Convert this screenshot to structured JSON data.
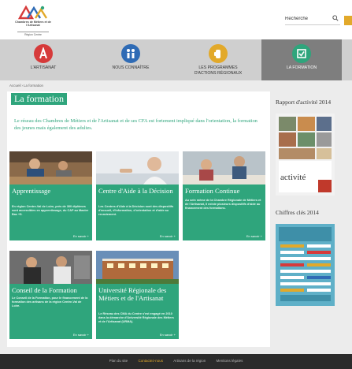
{
  "header": {
    "logo_title": "Chambres de Métiers et de l'Artisanat",
    "logo_region": "Région Centre",
    "search_placeholder": "Recherche"
  },
  "nav": [
    {
      "label": "L'ARTISANAT",
      "color": "#d63a3a",
      "icon": "letter-a-icon"
    },
    {
      "label": "NOUS CONNAÎTRE",
      "color": "#2f6bb5",
      "icon": "people-icon"
    },
    {
      "label": "LES PROGRAMMES D'ACTIONS RÉGIONAUX",
      "color": "#e2a92a",
      "icon": "hand-icon"
    },
    {
      "label": "LA FORMATION",
      "color": "#2fa57c",
      "icon": "book-icon",
      "active": true
    }
  ],
  "breadcrumb": {
    "home": "Accueil",
    "current": "La formation"
  },
  "main": {
    "title": "La formation",
    "intro": "Le réseau des Chambres de Métiers et de l'Artisanat et de ses CFA est fortement impliqué dans l'orientation, la formation des jeunes mais également des adultes."
  },
  "cards": [
    {
      "title": "Apprentissage",
      "desc": "En région Centre-Val de Loire, près de 300 diplômes sont accessibles en apprentissage, du CAP au Master Bac +5.",
      "more": "En savoir +"
    },
    {
      "title": "Centre d'Aide à la Décision",
      "desc": "Les Centres d'Aide à la Décision sont des dispositifs d'accueil, d'information, d'orientation et d'aide au recrutement.",
      "more": "En savoir +"
    },
    {
      "title": "Formation Continue",
      "desc": "Au sein même de la Chambre Régionale de Métiers et de l'Artisanat, il existe plusieurs dispositifs d'aide au financement des formations.",
      "more": "En savoir +"
    },
    {
      "title": "Conseil de la Formation",
      "desc": "Le Conseil de la Formation, pour le financement de la formation des artisans de la région Centre-Val de Loire.",
      "more": "En savoir +"
    },
    {
      "title": "Université Régionale des Métiers et de l'Artisanat",
      "desc": "Le Réseau des CMA du Centre s'est engagé en 2010 dans la démarche d'Université Régionale des Métiers et de l'Artisanat (URMA).",
      "more": "En savoir +"
    }
  ],
  "sidebar": {
    "report_title": "Rapport d'activité 2014",
    "report_cover_word": "activité",
    "chiffres_title": "Chiffres clés 2014"
  },
  "footer": {
    "links": [
      "Plan du site",
      "Contactez-nous",
      "Artisans de la région",
      "Mentions légales"
    ]
  },
  "colors": {
    "accent": "#2fa57c",
    "footer": "#2b2b2b",
    "highlight": "#e2a92a"
  }
}
